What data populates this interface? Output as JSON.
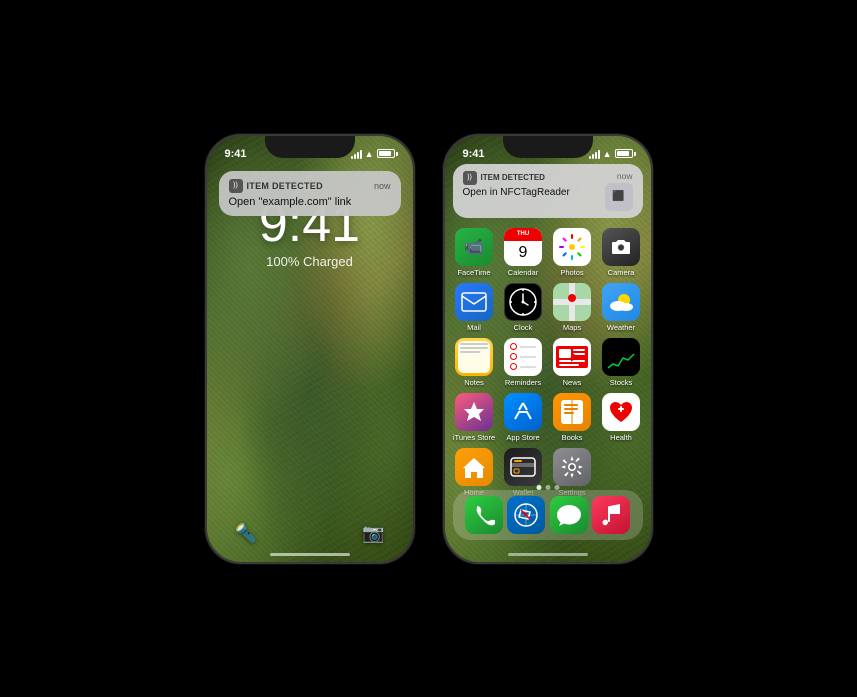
{
  "page": {
    "background": "#000000"
  },
  "phone_left": {
    "type": "lock_screen",
    "status_bar": {
      "time": "9:41",
      "signal": "●●●",
      "wifi": "wifi",
      "battery": "full"
    },
    "lock_time": "9:41",
    "lock_charged": "100% Charged",
    "notification": {
      "icon": "))",
      "title": "ITEM DETECTED",
      "time": "now",
      "body": "Open \"example.com\" link"
    },
    "controls": {
      "left": "🔦",
      "right": "📷"
    }
  },
  "phone_right": {
    "type": "home_screen",
    "status_bar": {
      "time": "9:41",
      "signal": "●●●",
      "wifi": "wifi",
      "battery": "full"
    },
    "top_notification": {
      "icon": "))",
      "title": "ITEM DETECTED",
      "time": "now",
      "body": "Open in NFCTagReader"
    },
    "apps": [
      {
        "name": "FaceTime",
        "icon_class": "app-facetime",
        "symbol": "📹"
      },
      {
        "name": "Calendar",
        "icon_class": "app-calendar",
        "symbol": "cal"
      },
      {
        "name": "Photos",
        "icon_class": "app-photos",
        "symbol": "photos"
      },
      {
        "name": "Camera",
        "icon_class": "app-camera",
        "symbol": "📷"
      },
      {
        "name": "Mail",
        "icon_class": "app-mail",
        "symbol": "✉️"
      },
      {
        "name": "Clock",
        "icon_class": "app-clock",
        "symbol": "clock"
      },
      {
        "name": "Maps",
        "icon_class": "app-maps",
        "symbol": "🗺"
      },
      {
        "name": "Weather",
        "icon_class": "app-weather",
        "symbol": "⛅"
      },
      {
        "name": "Notes",
        "icon_class": "app-notes",
        "symbol": "📝"
      },
      {
        "name": "Reminders",
        "icon_class": "app-reminders",
        "symbol": "☑️"
      },
      {
        "name": "News",
        "icon_class": "app-news",
        "symbol": "📰"
      },
      {
        "name": "Stocks",
        "icon_class": "app-stocks",
        "symbol": "📈"
      },
      {
        "name": "iTunes Store",
        "icon_class": "app-itunes",
        "symbol": "⭐"
      },
      {
        "name": "App Store",
        "icon_class": "app-appstore",
        "symbol": "🅰"
      },
      {
        "name": "Books",
        "icon_class": "app-books",
        "symbol": "📚"
      },
      {
        "name": "Health",
        "icon_class": "app-health",
        "symbol": "❤️"
      },
      {
        "name": "Home",
        "icon_class": "app-home",
        "symbol": "🏠"
      },
      {
        "name": "Wallet",
        "icon_class": "app-wallet",
        "symbol": "💳"
      },
      {
        "name": "Settings",
        "icon_class": "app-settings",
        "symbol": "⚙️"
      }
    ],
    "dock": [
      {
        "name": "Phone",
        "icon_class": "app-facetime",
        "symbol": "📞",
        "color": "#2ecc40"
      },
      {
        "name": "Safari",
        "icon_class": "app-weather",
        "symbol": "🧭",
        "color": "#0a84ff"
      },
      {
        "name": "Messages",
        "icon_class": "app-facetime",
        "symbol": "💬",
        "color": "#2ecc40"
      },
      {
        "name": "Music",
        "icon_class": "app-itunes",
        "symbol": "🎵",
        "color": "#fc5c7d"
      }
    ]
  }
}
